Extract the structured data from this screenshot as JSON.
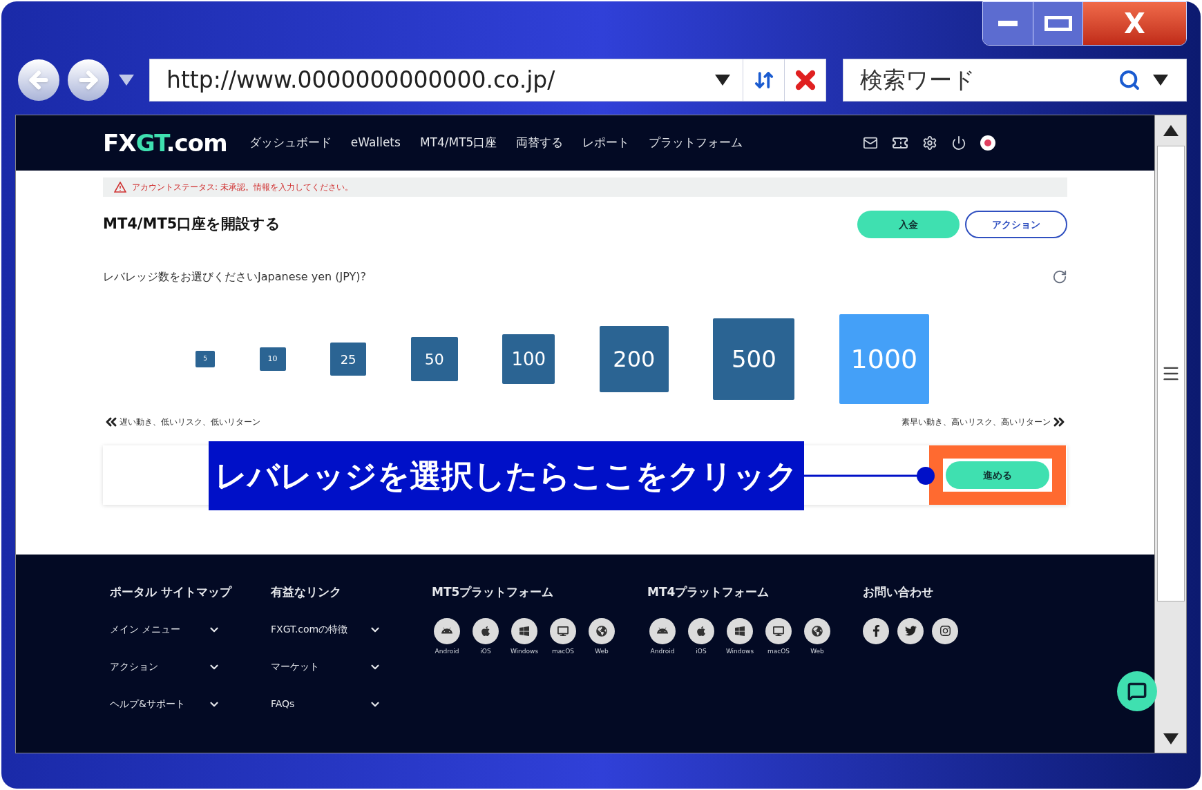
{
  "window": {
    "close_label": "X"
  },
  "address_bar": {
    "url": "http://www.0000000000000.co.jp/",
    "search_placeholder": "検索ワード"
  },
  "site": {
    "logo": [
      {
        "text": "FX",
        "accent": false
      },
      {
        "text": "GT",
        "accent": true
      },
      {
        "text": ".com",
        "accent": false
      }
    ],
    "nav": [
      "ダッシュボード",
      "eWallets",
      "MT4/MT5口座",
      "両替する",
      "レポート",
      "プラットフォーム"
    ],
    "warning": "アカウントステータス: 未承認。情報を入力してください。",
    "title": "MT4/MT5口座を開設する",
    "buttons": [
      {
        "label": "入金",
        "kind": "filled"
      },
      {
        "label": "アクション",
        "kind": "outline"
      }
    ],
    "question": "レバレッジ数をお選びくださいJapanese yen (JPY)?",
    "leverage": [
      {
        "label": "5",
        "selected": false
      },
      {
        "label": "10",
        "selected": false
      },
      {
        "label": "25",
        "selected": false
      },
      {
        "label": "50",
        "selected": false
      },
      {
        "label": "100",
        "selected": false
      },
      {
        "label": "200",
        "selected": false
      },
      {
        "label": "500",
        "selected": false
      },
      {
        "label": "1000",
        "selected": true
      }
    ],
    "scale_left": "遅い動き、低いリスク、低いリターン",
    "scale_right": "素早い動き、高いリスク、高いリターン",
    "annotation": "レバレッジを選択したらここをクリック",
    "proceed": "進める",
    "footer": {
      "sitemap": {
        "title": "ポータル サイトマップ",
        "items": [
          "メイン メニュー",
          "アクション",
          "ヘルプ&サポート"
        ]
      },
      "links": {
        "title": "有益なリンク",
        "items": [
          "FXGT.comの特徴",
          "マーケット",
          "FAQs"
        ]
      },
      "platforms": [
        {
          "title": "MT5プラットフォーム",
          "items": [
            "Android",
            "iOS",
            "Windows",
            "macOS",
            "Web"
          ]
        },
        {
          "title": "MT4プラットフォーム",
          "items": [
            "Android",
            "iOS",
            "Windows",
            "macOS",
            "Web"
          ]
        }
      ],
      "contact": {
        "title": "お問い合わせ"
      }
    }
  }
}
